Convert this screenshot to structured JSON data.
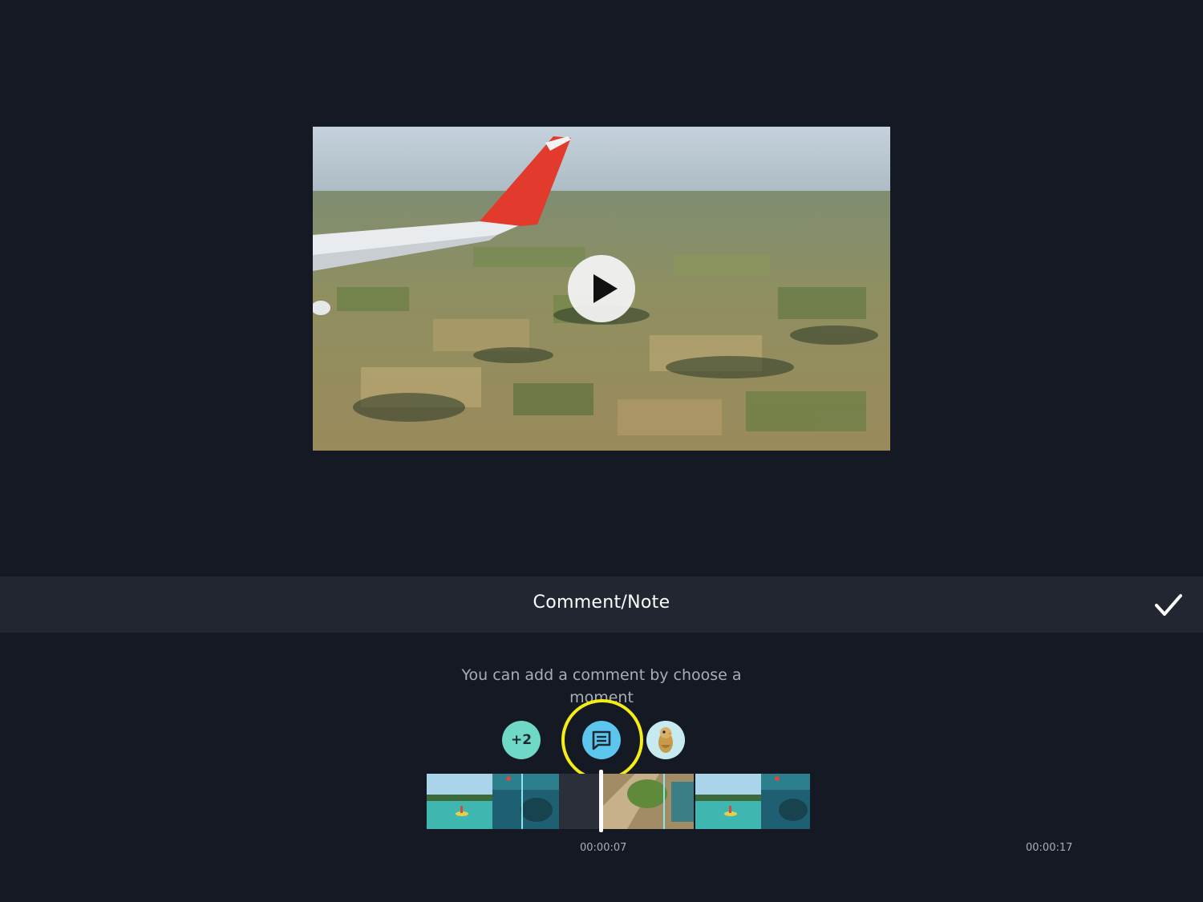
{
  "header": {
    "title": "Comment/Note",
    "confirm_icon": "checkmark-icon"
  },
  "preview": {
    "play_icon": "play-icon"
  },
  "hint": {
    "text": "You can add a comment by choose a moment"
  },
  "markers": {
    "more_label": "+2",
    "comment_icon": "comment-icon",
    "avatar_icon": "bird-avatar-icon",
    "highlight_color": "#f5ee16"
  },
  "timeline": {
    "current_time": "00:00:07",
    "end_time": "00:00:17"
  },
  "colors": {
    "background": "#151923",
    "header_bar": "#222630",
    "comment_marker": "#5cc6ee",
    "more_marker": "#6fd8c6"
  }
}
